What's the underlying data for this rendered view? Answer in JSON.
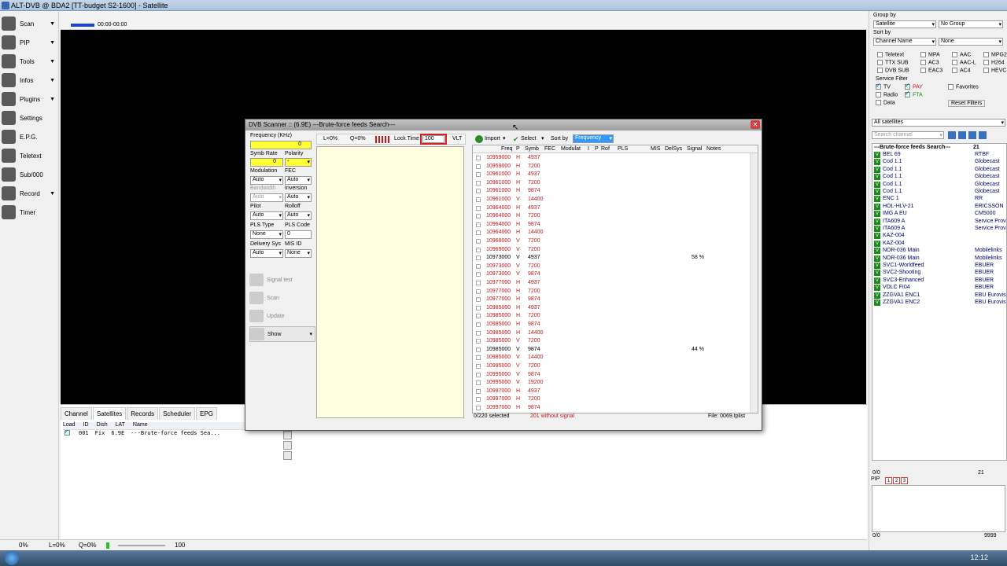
{
  "window": {
    "title": "ALT-DVB @ BDA2 [TT-budget S2-1600] - Satellite"
  },
  "left_menu": [
    {
      "label": "Scan",
      "icon": "scan-icon",
      "arrow": "▼"
    },
    {
      "label": "PIP",
      "icon": "pip-icon",
      "arrow": "▼"
    },
    {
      "label": "Tools",
      "icon": "tools-icon",
      "arrow": "▼"
    },
    {
      "label": "Infos",
      "icon": "info-icon",
      "arrow": "▼"
    },
    {
      "label": "Plugins",
      "icon": "plugins-icon",
      "arrow": "▼"
    },
    {
      "label": "Settings",
      "icon": "settings-icon",
      "arrow": ""
    },
    {
      "label": "E.P.G.",
      "icon": "epg-icon",
      "arrow": ""
    },
    {
      "label": "Teletext",
      "icon": "teletext-icon",
      "arrow": ""
    },
    {
      "label": "Sub/000",
      "icon": "subtitle-icon",
      "arrow": ""
    },
    {
      "label": "Record",
      "icon": "record-icon",
      "arrow": "▼"
    },
    {
      "label": "Timer",
      "icon": "timer-icon",
      "arrow": ""
    }
  ],
  "player": {
    "timecode": "00:00-00:00"
  },
  "bottom_tabs": [
    "Channel",
    "Satellites",
    "Records",
    "Scheduler",
    "EPG"
  ],
  "sat_table": {
    "headers": [
      "Load",
      "ID",
      "Dish",
      "LAT",
      "Name"
    ],
    "row": {
      "id": "001",
      "dish": "Fix",
      "lat": "6.9E",
      "name": "---Brute-force feeds Sea..."
    }
  },
  "statusbar": {
    "volume": "0%",
    "l": "L=0%",
    "q": "Q=0%",
    "vol_num": "100"
  },
  "clock": "12:12",
  "right": {
    "group_by_label": "Group by",
    "group_by": "Satellite",
    "group_by2": "No Group",
    "sort_by_label": "Sort by",
    "sort_by": "Channel Name",
    "sort_by2": "None",
    "filters": [
      [
        "Teletext",
        "MPA",
        "AAC",
        "MPG2"
      ],
      [
        "TTX SUB",
        "AC3",
        "AAC-L",
        "H264"
      ],
      [
        "DVB SUB",
        "EAC3",
        "AC4",
        "HEVC"
      ]
    ],
    "service_filter_label": "Service Filter",
    "tv": "TV",
    "pay": "PAY",
    "radio": "Radio",
    "fta": "FTA",
    "data": "Data",
    "favorites": "Favorites",
    "reset_filters": "Reset Filters",
    "all_satellites": "All satellites",
    "search_placeholder": "Search channel",
    "list_header": "---Brute-force feeds Search---",
    "list_count": "21",
    "channels": [
      {
        "name": "BEL 69",
        "provider": "RTBF"
      },
      {
        "name": "Cod 1.1",
        "provider": "Globecast"
      },
      {
        "name": "Cod 1.1",
        "provider": "Globecast"
      },
      {
        "name": "Cod 1.1",
        "provider": "Globecast"
      },
      {
        "name": "Cod 1.1",
        "provider": "Globecast"
      },
      {
        "name": "Cod 1.1",
        "provider": "Globecast"
      },
      {
        "name": "ENC 1",
        "provider": "RR"
      },
      {
        "name": "HOL-HLV-21",
        "provider": "ERICSSON"
      },
      {
        "name": "IMG A EU",
        "provider": "CM5000"
      },
      {
        "name": "ITA609 A",
        "provider": "Service Prov"
      },
      {
        "name": "ITA609 A",
        "provider": "Service Prov"
      },
      {
        "name": "KAZ-004",
        "provider": ""
      },
      {
        "name": "KAZ-004",
        "provider": ""
      },
      {
        "name": "NOR-036 Main",
        "provider": "Mobilelinks"
      },
      {
        "name": "NOR-036 Main",
        "provider": "Mobilelinks"
      },
      {
        "name": "SVC1-Worldfeed",
        "provider": "EBUER"
      },
      {
        "name": "SVC2-Shooting",
        "provider": "EBUER"
      },
      {
        "name": "SVC3-Enhanced",
        "provider": "EBUER"
      },
      {
        "name": "VDLC FI04",
        "provider": "EBUER"
      },
      {
        "name": "ZZGVA1 ENC1",
        "provider": "EBU Eurovis"
      },
      {
        "name": "ZZGVA1 ENC2",
        "provider": "EBU Eurovis"
      }
    ],
    "footer_left": "0/0",
    "footer_right": "21",
    "pip_label": "PIP",
    "pip_tabs": [
      "1",
      "2",
      "3"
    ],
    "pip_footer_left": "0/0",
    "pip_footer_right": "9999"
  },
  "dialog": {
    "title": "DVB Scanner :: (6.9E) ---Brute-force feeds Search---",
    "frequency_label": "Frequency (KHz)",
    "frequency": "0",
    "symb_rate_label": "Symb Rate",
    "symb_rate": "0",
    "polarity_label": "Polarity",
    "polarity": "-",
    "modulation_label": "Modulation",
    "modulation": "Auto",
    "fec_label": "FEC",
    "fec": "Auto",
    "bandwidth_label": "Bandwidth",
    "bandwidth": "Auto",
    "inversion_label": "Inversion",
    "inversion": "Auto",
    "pilot_label": "Pilot",
    "pilot": "Auto",
    "rolloff_label": "Rolloff",
    "rolloff": "Auto",
    "pls_type_label": "PLS Type",
    "pls_type": "None",
    "pls_code_label": "PLS Code",
    "pls_code": "0",
    "delivery_label": "Delivery Sys",
    "delivery": "Auto",
    "mis_id_label": "MIS ID",
    "mis_id": "None",
    "signal_test": "Signal test",
    "scan": "Scan",
    "update": "Update",
    "show": "Show",
    "level": "L=0%",
    "quality": "Q=0%",
    "lock_time_label": "Lock Time",
    "lock_time": "100",
    "vlt": "VLT",
    "import": "Import",
    "select": "Select",
    "sort_by_label": "Sort by",
    "sort_by": "Frequency",
    "columns": [
      "Freq",
      "P",
      "Symb",
      "FEC",
      "Modulat",
      "I",
      "P",
      "Rof",
      "PLS",
      "MIS",
      "DelSys",
      "Signal",
      "Notes"
    ],
    "rows": [
      {
        "freq": "10959000",
        "pol": "H",
        "symb": "4937",
        "signal": ""
      },
      {
        "freq": "10959000",
        "pol": "H",
        "symb": "7200",
        "signal": ""
      },
      {
        "freq": "10961000",
        "pol": "H",
        "symb": "4937",
        "signal": ""
      },
      {
        "freq": "10961000",
        "pol": "H",
        "symb": "7200",
        "signal": ""
      },
      {
        "freq": "10961000",
        "pol": "H",
        "symb": "9874",
        "signal": ""
      },
      {
        "freq": "10961000",
        "pol": "V",
        "symb": "14400",
        "signal": ""
      },
      {
        "freq": "10964000",
        "pol": "H",
        "symb": "4937",
        "signal": ""
      },
      {
        "freq": "10964000",
        "pol": "H",
        "symb": "7200",
        "signal": ""
      },
      {
        "freq": "10964000",
        "pol": "H",
        "symb": "9874",
        "signal": ""
      },
      {
        "freq": "10964000",
        "pol": "H",
        "symb": "14400",
        "signal": ""
      },
      {
        "freq": "10968000",
        "pol": "V",
        "symb": "7200",
        "signal": ""
      },
      {
        "freq": "10969000",
        "pol": "V",
        "symb": "7200",
        "signal": ""
      },
      {
        "freq": "10973000",
        "pol": "V",
        "symb": "4937",
        "signal": "58 %"
      },
      {
        "freq": "10973000",
        "pol": "V",
        "symb": "7200",
        "signal": ""
      },
      {
        "freq": "10973000",
        "pol": "V",
        "symb": "9874",
        "signal": ""
      },
      {
        "freq": "10977000",
        "pol": "H",
        "symb": "4937",
        "signal": ""
      },
      {
        "freq": "10977000",
        "pol": "H",
        "symb": "7200",
        "signal": ""
      },
      {
        "freq": "10977000",
        "pol": "H",
        "symb": "9874",
        "signal": ""
      },
      {
        "freq": "10985000",
        "pol": "H",
        "symb": "4937",
        "signal": ""
      },
      {
        "freq": "10985000",
        "pol": "H",
        "symb": "7200",
        "signal": ""
      },
      {
        "freq": "10985000",
        "pol": "H",
        "symb": "9874",
        "signal": ""
      },
      {
        "freq": "10985000",
        "pol": "H",
        "symb": "14400",
        "signal": ""
      },
      {
        "freq": "10985000",
        "pol": "V",
        "symb": "7200",
        "signal": ""
      },
      {
        "freq": "10985000",
        "pol": "V",
        "symb": "9874",
        "signal": "44 %"
      },
      {
        "freq": "10985000",
        "pol": "V",
        "symb": "14400",
        "signal": ""
      },
      {
        "freq": "10995000",
        "pol": "V",
        "symb": "7200",
        "signal": ""
      },
      {
        "freq": "10995000",
        "pol": "V",
        "symb": "9874",
        "signal": ""
      },
      {
        "freq": "10995000",
        "pol": "V",
        "symb": "19200",
        "signal": ""
      },
      {
        "freq": "10997000",
        "pol": "H",
        "symb": "4937",
        "signal": ""
      },
      {
        "freq": "10997000",
        "pol": "H",
        "symb": "7200",
        "signal": ""
      },
      {
        "freq": "10997000",
        "pol": "H",
        "symb": "9874",
        "signal": ""
      }
    ],
    "selected": "0/220 selected",
    "without_signal": "201 without signal",
    "file": "File: 0069.tplist"
  }
}
